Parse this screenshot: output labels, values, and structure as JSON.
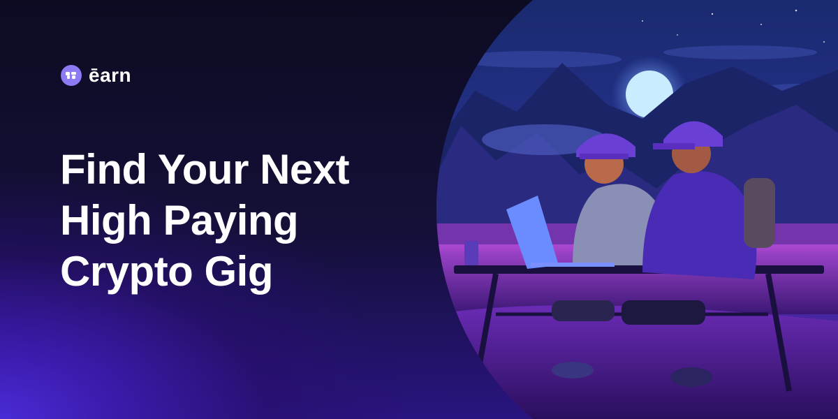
{
  "brand": {
    "name": "ēarn",
    "mark_icon": "earn-logo-icon",
    "accent": "#8b7cf6"
  },
  "hero": {
    "lines": [
      "Find Your Next",
      "High Paying",
      "Crypto Gig"
    ]
  },
  "illustration": {
    "subject": "two people working on a laptop at a table under a night sky with mountains and moon"
  },
  "colors": {
    "background_dark": "#0d0b22",
    "glow": "#4a2bd6",
    "text": "#ffffff"
  }
}
